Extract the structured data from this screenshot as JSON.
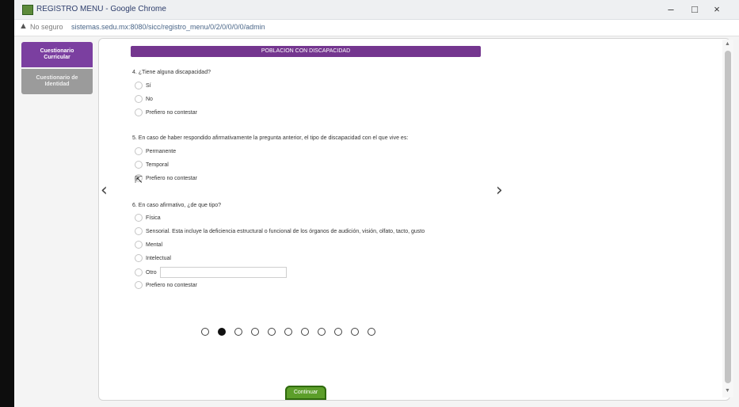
{
  "window": {
    "title": "REGISTRO MENU - Google Chrome",
    "controls": [
      "–",
      "□",
      "×"
    ]
  },
  "address_bar": {
    "security_label": "No seguro",
    "url": "sistemas.sedu.mx:8080/sicc/registro_menu/0/2/0/0/0/0/admin"
  },
  "sidebar": {
    "items": [
      {
        "label": "Cuestionario Curricular"
      },
      {
        "label": "Cuestionario de Identidad"
      }
    ]
  },
  "section_header": "POBLACION CON DISCAPACIDAD",
  "questions": [
    {
      "text": "4. ¿Tiene alguna discapacidad?",
      "options": [
        "Sí",
        "No",
        "Prefiero no contestar"
      ]
    },
    {
      "text": "5. En caso de haber respondido afirmativamente la pregunta anterior, el tipo de discapacidad con el que vive es:",
      "options": [
        "Permanente",
        "Temporal",
        "Prefiero no contestar"
      ]
    },
    {
      "text": "6. En caso afirmativo, ¿de que tipo?",
      "options": [
        "Física",
        "Sensorial. Esta incluye la deficiencia estructural o funcional de los órganos de audición, visión, olfato, tacto, gusto",
        "Mental",
        "Intelectual",
        "Otro",
        "Prefiero no contestar"
      ]
    }
  ],
  "nav": {
    "prev_symbol": "‹",
    "next_symbol": "›"
  },
  "pagination": {
    "total": 11,
    "active_index": 1
  },
  "continue_label": "Continuar"
}
